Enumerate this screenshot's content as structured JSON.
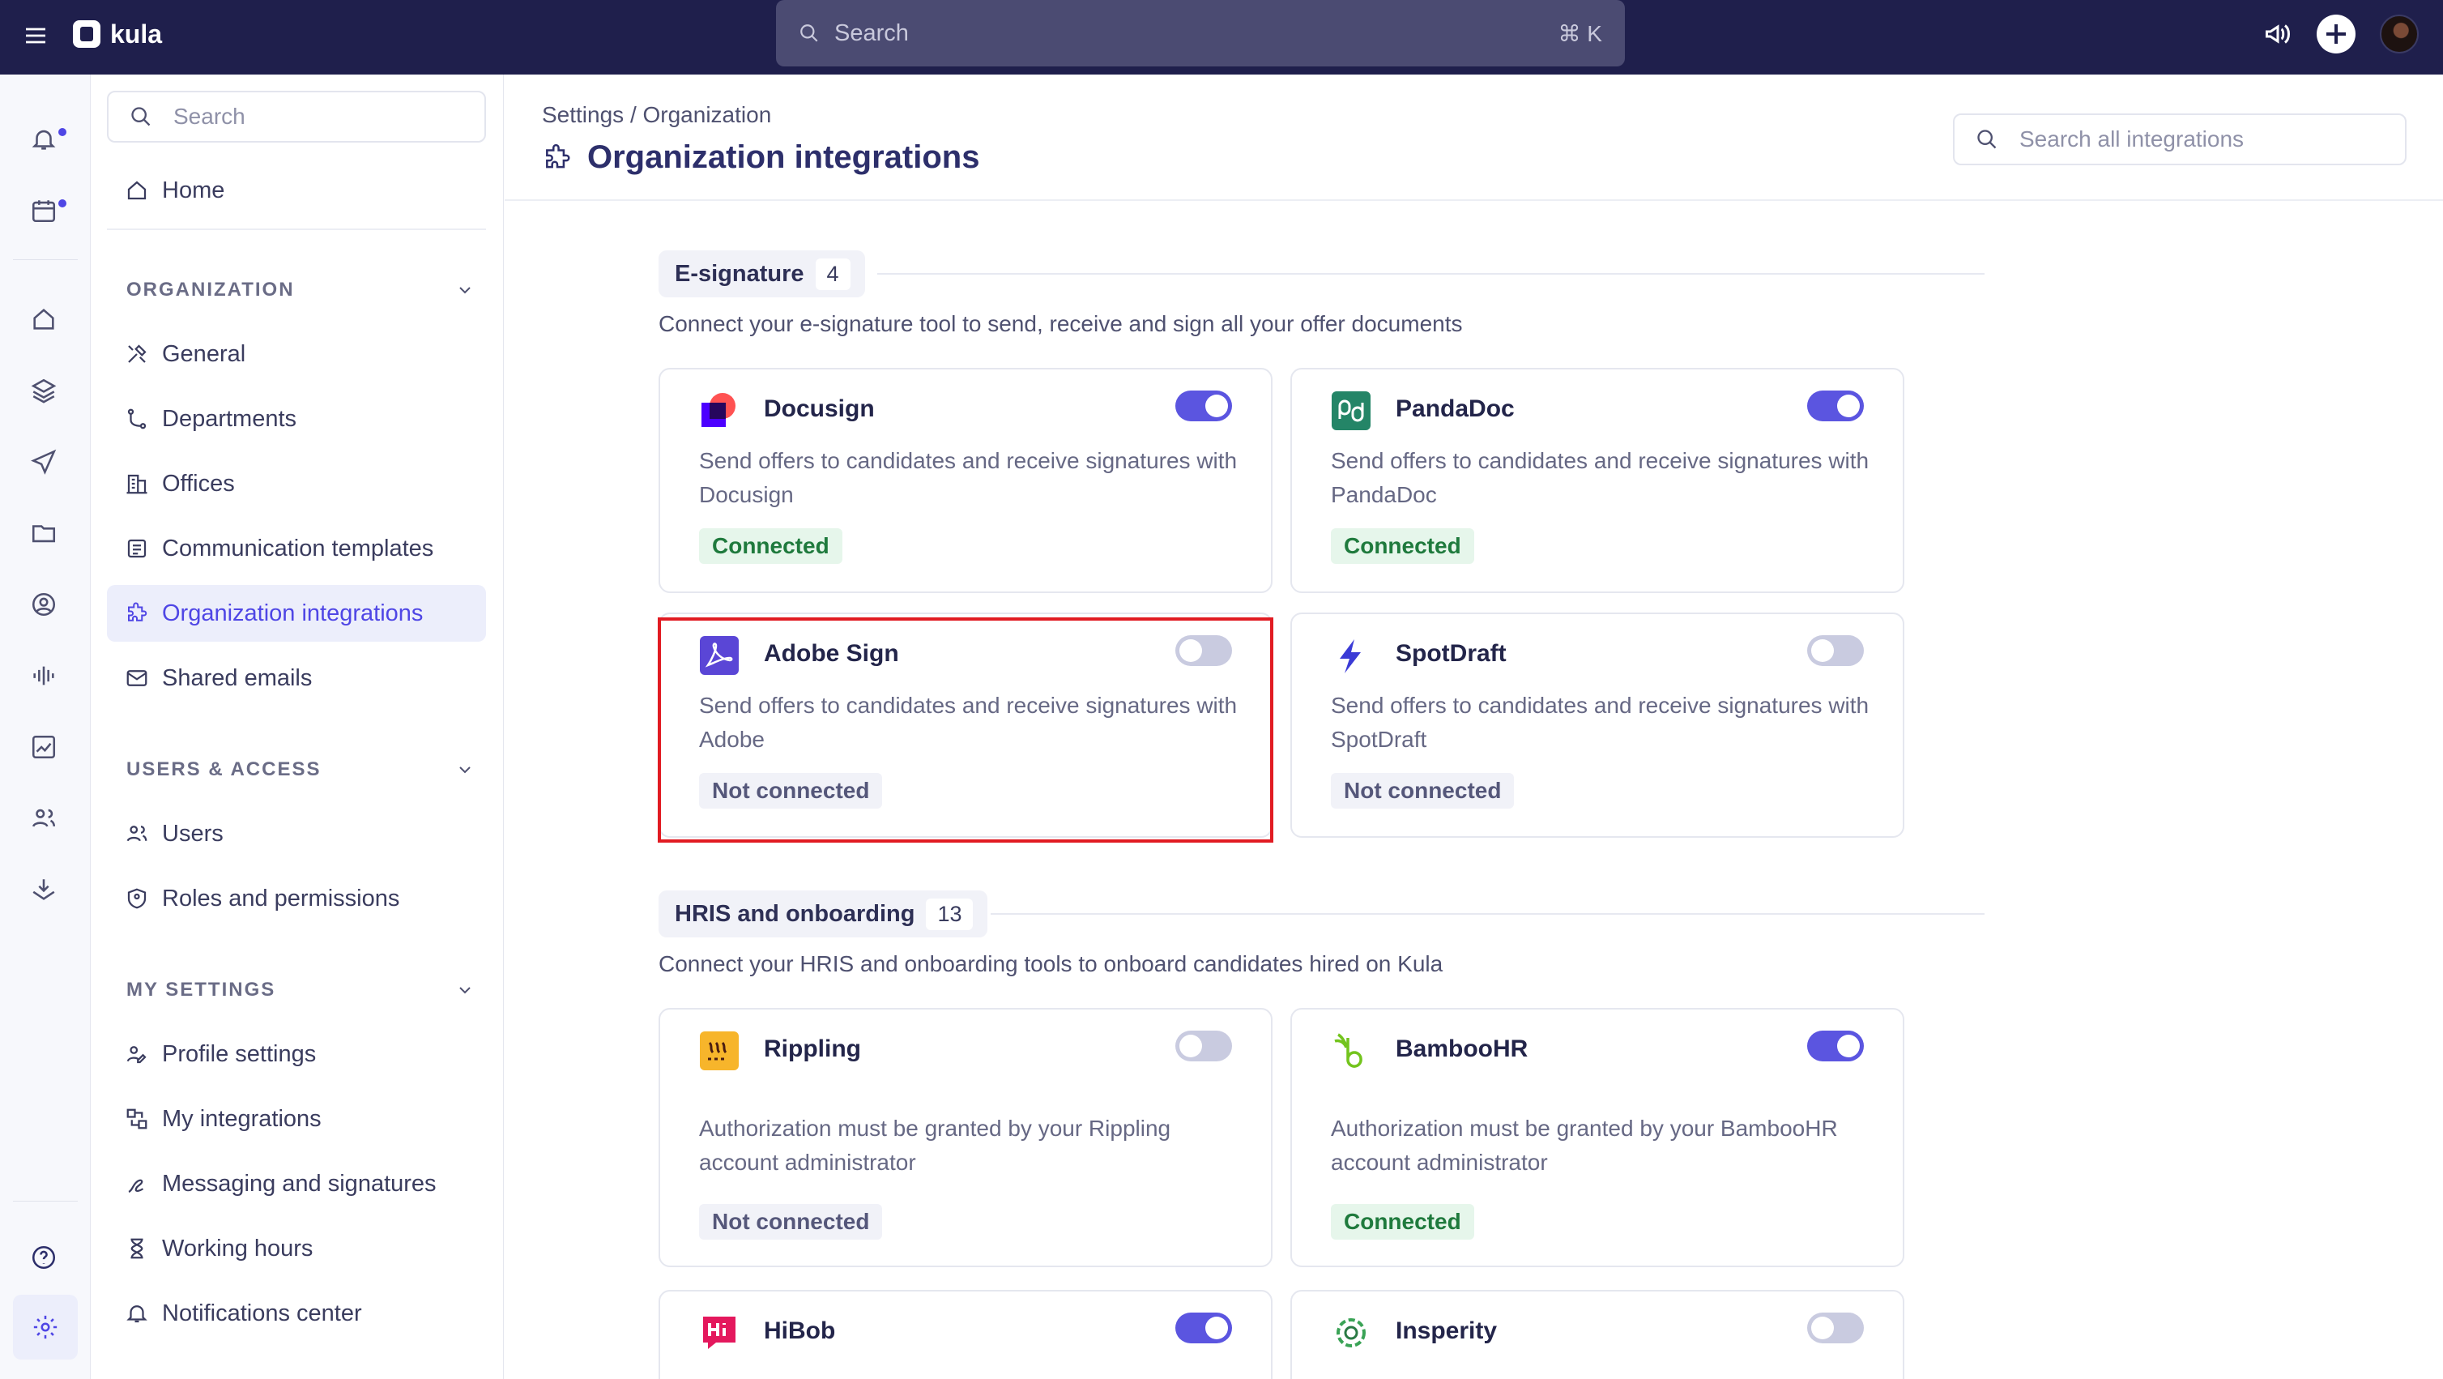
{
  "app": {
    "name": "kula"
  },
  "topbar": {
    "search_placeholder": "Search",
    "shortcut": "⌘ K"
  },
  "sidebar": {
    "search_placeholder": "Search",
    "home": "Home",
    "sections": {
      "organization": "ORGANIZATION",
      "users_access": "USERS & ACCESS",
      "my_settings": "MY SETTINGS"
    },
    "org_items": [
      "General",
      "Departments",
      "Offices",
      "Communication templates",
      "Organization integrations",
      "Shared emails"
    ],
    "users_items": [
      "Users",
      "Roles and permissions"
    ],
    "settings_items": [
      "Profile settings",
      "My integrations",
      "Messaging and signatures",
      "Working hours",
      "Notifications center"
    ]
  },
  "header": {
    "breadcrumb": "Settings / Organization",
    "title": "Organization integrations",
    "search_placeholder": "Search all integrations"
  },
  "esignature": {
    "label": "E-signature",
    "count": "4",
    "description": "Connect your e-signature tool to send, receive and sign all your offer documents",
    "cards": [
      {
        "name": "Docusign",
        "description": "Send offers to candidates and receive signatures with Docusign",
        "status": "Connected",
        "enabled": true
      },
      {
        "name": "PandaDoc",
        "description": "Send offers to candidates and receive signatures with PandaDoc",
        "status": "Connected",
        "enabled": true
      },
      {
        "name": "Adobe Sign",
        "description": "Send offers to candidates and receive signatures with Adobe",
        "status": "Not connected",
        "enabled": false
      },
      {
        "name": "SpotDraft",
        "description": "Send offers to candidates and receive signatures with SpotDraft",
        "status": "Not connected",
        "enabled": false
      }
    ]
  },
  "hris": {
    "label": "HRIS and onboarding",
    "count": "13",
    "description": "Connect your HRIS and onboarding tools to onboard candidates hired on Kula",
    "cards": [
      {
        "name": "Rippling",
        "description": "Authorization must be granted by your Rippling account administrator",
        "status": "Not connected",
        "enabled": false
      },
      {
        "name": "BambooHR",
        "description": "Authorization must be granted by your BambooHR account administrator",
        "status": "Connected",
        "enabled": true
      },
      {
        "name": "HiBob",
        "enabled": true
      },
      {
        "name": "Insperity",
        "enabled": false
      }
    ]
  },
  "colors": {
    "topbar": "#1f1f4c",
    "accent": "#5b55e0",
    "connected_bg": "#e6f6eb",
    "connected_text": "#1f7a3d",
    "highlight": "#e11b22"
  }
}
